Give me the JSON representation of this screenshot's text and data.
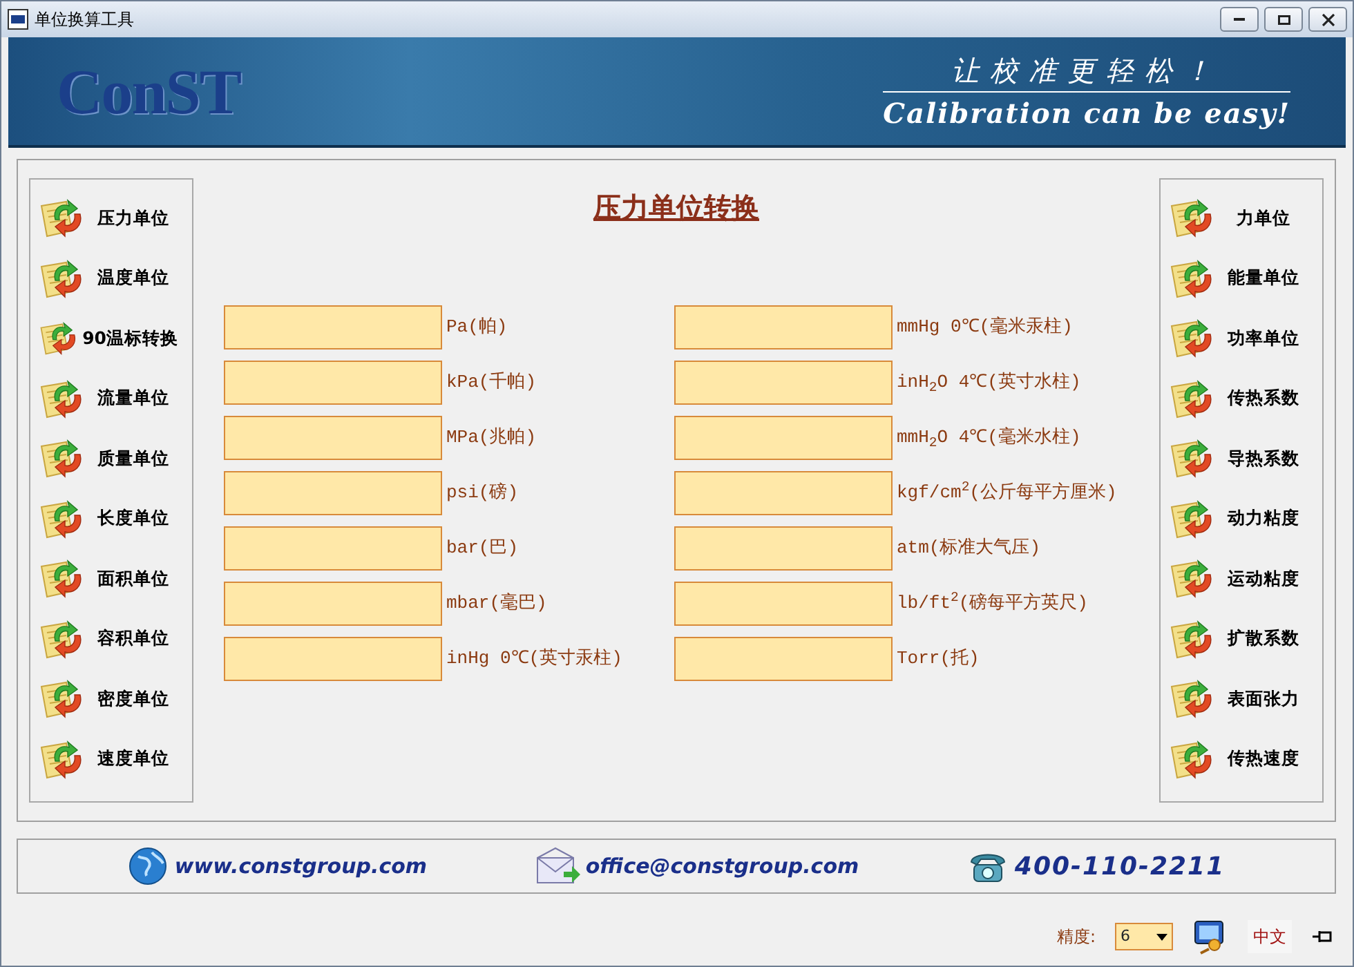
{
  "window": {
    "title": "单位换算工具"
  },
  "banner": {
    "logo": "ConST",
    "slogan": "让校准更轻松！",
    "tagline": "Calibration can be easy!"
  },
  "left_menu": [
    {
      "label": "压力单位"
    },
    {
      "label": "温度单位"
    },
    {
      "label": "90温标转换"
    },
    {
      "label": "流量单位"
    },
    {
      "label": "质量单位"
    },
    {
      "label": "长度单位"
    },
    {
      "label": "面积单位"
    },
    {
      "label": "容积单位"
    },
    {
      "label": "密度单位"
    },
    {
      "label": "速度单位"
    }
  ],
  "heading": "压力单位转换",
  "left_fields": [
    {
      "label": "Pa(帕)"
    },
    {
      "label": "kPa(千帕)"
    },
    {
      "label": "MPa(兆帕)"
    },
    {
      "label": "psi(磅)"
    },
    {
      "label": "bar(巴)"
    },
    {
      "label": "mbar(毫巴)"
    },
    {
      "label": "inHg 0℃(英寸汞柱)"
    }
  ],
  "right_fields": [
    {
      "label": "mmHg 0℃(毫米汞柱)"
    },
    {
      "label": "inH$_{2}$O 4℃(英寸水柱)"
    },
    {
      "label": "mmH$_{2}$O 4℃(毫米水柱)"
    },
    {
      "label": "kgf/cm$^{2}$(公斤每平方厘米)"
    },
    {
      "label": "atm(标准大气压)"
    },
    {
      "label": "lb/ft$^{2}$(磅每平方英尺)"
    },
    {
      "label": "Torr(托)"
    }
  ],
  "right_menu": [
    {
      "label": "力单位"
    },
    {
      "label": "能量单位"
    },
    {
      "label": "功率单位"
    },
    {
      "label": "传热系数"
    },
    {
      "label": "导热系数"
    },
    {
      "label": "动力粘度"
    },
    {
      "label": "运动粘度"
    },
    {
      "label": "扩散系数"
    },
    {
      "label": "表面张力"
    },
    {
      "label": "传热速度"
    }
  ],
  "contacts": [
    {
      "kind": "web",
      "text": "www.constgroup.com"
    },
    {
      "kind": "mail",
      "text": "office@constgroup.com"
    },
    {
      "kind": "phone",
      "text": "400-110-2211"
    }
  ],
  "status_bar": {
    "precision_label": "精度:",
    "precision_value": "6",
    "language": "中文"
  }
}
